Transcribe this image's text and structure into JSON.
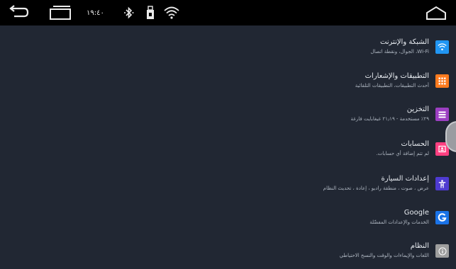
{
  "status_bar": {
    "clock": "١٩:٤٠",
    "icons": {
      "back": "back-arrow-icon",
      "recent": "recent-apps-icon",
      "bluetooth": "bluetooth-icon",
      "usb": "usb-icon",
      "wifi": "wifi-icon",
      "home": "home-icon"
    }
  },
  "settings": {
    "items": [
      {
        "title": "الشبكة والإنترنت",
        "subtitle": "Wi-Fi، الجوال، ونقطة اتصال",
        "icon": "wifi-icon",
        "color": "#2196f3"
      },
      {
        "title": "التطبيقات والإشعارات",
        "subtitle": "أحدث التطبيقات، التطبيقات التلقائية",
        "icon": "apps-grid-icon",
        "color": "#ff7b1f"
      },
      {
        "title": "التخزين",
        "subtitle": "٢٩٪ مستخدمة - ٢١٫١٩ غيغابايت فارغة",
        "icon": "storage-icon",
        "color": "#9c3fc2"
      },
      {
        "title": "الحسابات",
        "subtitle": "لم تتم إضافة أي حسابات.",
        "icon": "account-icon",
        "color": "#ff4081"
      },
      {
        "title": "إعدادات السيارة",
        "subtitle": "عرض ، صوت ، منطقة راديو ، إعادة ، تحديث النظام",
        "icon": "person-icon",
        "color": "#4e3bd1"
      },
      {
        "title": "Google",
        "subtitle": "الخدمات والإعدادات المفضّلة",
        "icon": "google-icon",
        "color": "#1a73e8"
      },
      {
        "title": "النظام",
        "subtitle": "اللغات والإيماءات والوقت والنسخ الاحتياطي",
        "icon": "info-icon",
        "color": "#9e9e9e"
      }
    ]
  }
}
